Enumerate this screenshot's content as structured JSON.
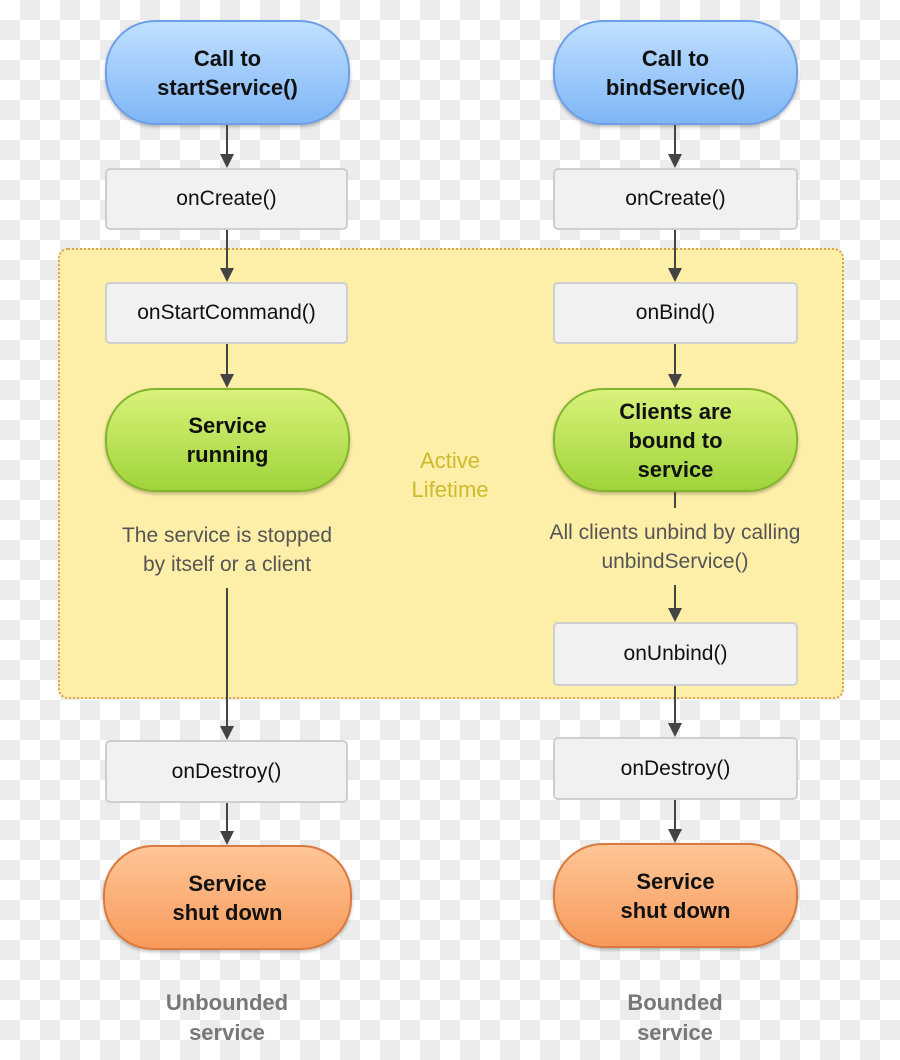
{
  "colors": {
    "start": "#7fb6f6",
    "running": "#9fd43a",
    "end": "#f79a5c",
    "method_box": "#f1f1f1",
    "active_region": "#fdeea8",
    "active_label": "#cdbb2e"
  },
  "active_label": [
    "Active",
    "Lifetime"
  ],
  "unbounded": {
    "start": [
      "Call to",
      "startService()"
    ],
    "on_create": "onCreate()",
    "on_start_command": "onStartCommand()",
    "running": [
      "Service",
      "running"
    ],
    "stop_note": [
      "The service is stopped",
      "by itself or a client"
    ],
    "on_destroy": "onDestroy()",
    "shut_down": [
      "Service",
      "shut down"
    ],
    "caption": [
      "Unbounded",
      "service"
    ]
  },
  "bounded": {
    "start": [
      "Call to",
      "bindService()"
    ],
    "on_create": "onCreate()",
    "on_bind": "onBind()",
    "bound": [
      "Clients are",
      "bound to",
      "service"
    ],
    "unbind_note": [
      "All clients unbind by calling",
      "unbindService()"
    ],
    "on_unbind": "onUnbind()",
    "on_destroy": "onDestroy()",
    "shut_down": [
      "Service",
      "shut down"
    ],
    "caption": [
      "Bounded",
      "service"
    ]
  }
}
